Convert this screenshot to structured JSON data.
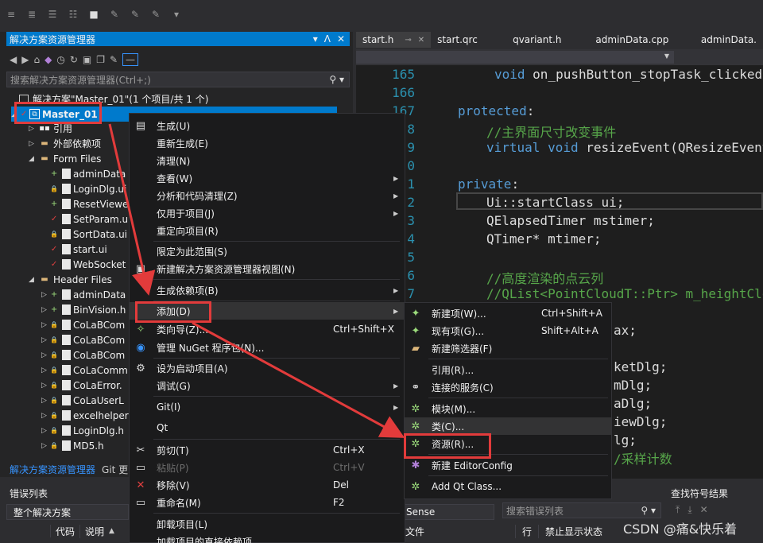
{
  "solution_explorer": {
    "title": "解决方案资源管理器",
    "title_buttons": [
      "▾",
      "ᐱ",
      "✕"
    ],
    "search_placeholder": "搜索解决方案资源管理器(Ctrl+;)",
    "solution_label": "解决方案\"Master_01\"(1 个项目/共 1 个)",
    "project": "Master_01",
    "tree": [
      {
        "label": "引用",
        "kind": "ref",
        "indent": 1
      },
      {
        "label": "外部依赖项",
        "kind": "ext",
        "indent": 1
      },
      {
        "label": "Form Files",
        "kind": "folder",
        "indent": 1
      },
      {
        "label": "adminData",
        "kind": "file",
        "indent": 2,
        "mark": "+"
      },
      {
        "label": "LoginDlg.ui",
        "kind": "file",
        "indent": 2,
        "mark": "lock"
      },
      {
        "label": "ResetViewer",
        "kind": "file",
        "indent": 2,
        "mark": "+"
      },
      {
        "label": "SetParam.ui",
        "kind": "file",
        "indent": 2,
        "mark": "check"
      },
      {
        "label": "SortData.ui",
        "kind": "file",
        "indent": 2,
        "mark": "lock"
      },
      {
        "label": "start.ui",
        "kind": "file",
        "indent": 2,
        "mark": "check"
      },
      {
        "label": "WebSocket",
        "kind": "file",
        "indent": 2,
        "mark": "check"
      },
      {
        "label": "Header Files",
        "kind": "folder",
        "indent": 1
      },
      {
        "label": "adminData",
        "kind": "hfile",
        "indent": 2,
        "mark": "+"
      },
      {
        "label": "BinVision.h",
        "kind": "hfile",
        "indent": 2,
        "mark": "+"
      },
      {
        "label": "CoLaBCom",
        "kind": "hfile",
        "indent": 2,
        "mark": "lock"
      },
      {
        "label": "CoLaBCom",
        "kind": "hfile",
        "indent": 2,
        "mark": "lock"
      },
      {
        "label": "CoLaBCom",
        "kind": "hfile",
        "indent": 2,
        "mark": "lock"
      },
      {
        "label": "CoLaComm",
        "kind": "hfile",
        "indent": 2,
        "mark": "lock"
      },
      {
        "label": "CoLaError.",
        "kind": "hfile",
        "indent": 2,
        "mark": "lock"
      },
      {
        "label": "CoLaUserL",
        "kind": "hfile",
        "indent": 2,
        "mark": "lock"
      },
      {
        "label": "excelhelper",
        "kind": "hfile",
        "indent": 2,
        "mark": "lock"
      },
      {
        "label": "LoginDlg.h",
        "kind": "hfile",
        "indent": 2,
        "mark": "lock"
      },
      {
        "label": "MD5.h",
        "kind": "hfile",
        "indent": 2,
        "mark": "lock"
      }
    ],
    "tabs": [
      "解决方案资源管理器",
      "Git 更"
    ]
  },
  "error_list": {
    "title": "错误列表",
    "scope": "整个解决方案",
    "columns": [
      "代码",
      "说明"
    ]
  },
  "editor": {
    "tabs": [
      "start.h",
      "start.qrc",
      "qvariant.h",
      "adminData.cpp",
      "adminData."
    ],
    "line_numbers": [
      "165",
      "166",
      "167",
      "8",
      "9",
      "0",
      "1",
      "2",
      "3",
      "4",
      "5",
      "6",
      "7"
    ]
  },
  "bottom": {
    "sense_label": "Sense",
    "error_search_placeholder": "搜索错误列表",
    "columns": [
      "文件",
      "行",
      "禁止显示状态"
    ],
    "find_title": "查找符号结果",
    "watermark": "CSDN @痛&快乐着"
  },
  "context_menu": {
    "items": [
      {
        "label": "生成(U)",
        "icon": "build-icon",
        "glyph": "▤"
      },
      {
        "label": "重新生成(E)"
      },
      {
        "label": "清理(N)"
      },
      {
        "label": "查看(W)",
        "submenu": true
      },
      {
        "label": "分析和代码清理(Z)",
        "submenu": true
      },
      {
        "label": "仅用于项目(J)",
        "submenu": true
      },
      {
        "label": "重定向项目(R)"
      },
      {
        "label": "限定为此范围(S)"
      },
      {
        "label": "新建解决方案资源管理器视图(N)",
        "icon": "new-view-icon",
        "glyph": "▣"
      },
      {
        "label": "生成依赖项(B)",
        "submenu": true
      },
      {
        "label": "添加(D)",
        "submenu": true,
        "highlight": true
      },
      {
        "label": "类向导(Z)...",
        "shortcut": "Ctrl+Shift+X",
        "icon": "class-wizard-icon",
        "glyph": "✧"
      },
      {
        "label": "管理 NuGet 程序包(N)...",
        "icon": "nuget-icon",
        "glyph": "◉"
      },
      {
        "label": "设为启动项目(A)",
        "icon": "gear-icon",
        "glyph": "⚙"
      },
      {
        "label": "调试(G)",
        "submenu": true
      },
      {
        "label": "Git(I)",
        "submenu": true
      },
      {
        "label": "Qt",
        "submenu": true
      },
      {
        "label": "剪切(T)",
        "shortcut": "Ctrl+X",
        "icon": "scissors-icon",
        "glyph": "✂"
      },
      {
        "label": "粘贴(P)",
        "shortcut": "Ctrl+V",
        "disabled": true,
        "icon": "paste-icon",
        "glyph": "▭"
      },
      {
        "label": "移除(V)",
        "shortcut": "Del",
        "icon": "remove-icon",
        "glyph": "✕"
      },
      {
        "label": "重命名(M)",
        "shortcut": "F2",
        "icon": "rename-icon",
        "glyph": "▭"
      },
      {
        "label": "卸载项目(L)"
      },
      {
        "label": "加载项目的直接依赖项"
      }
    ]
  },
  "add_submenu": {
    "items": [
      {
        "label": "新建项(W)...",
        "shortcut": "Ctrl+Shift+A",
        "icon": "new-item-icon",
        "glyph": "✦"
      },
      {
        "label": "现有项(G)...",
        "shortcut": "Shift+Alt+A",
        "icon": "existing-item-icon",
        "glyph": "✦"
      },
      {
        "label": "新建筛选器(F)",
        "icon": "new-filter-icon",
        "glyph": "▰"
      },
      {
        "label": "引用(R)..."
      },
      {
        "label": "连接的服务(C)",
        "icon": "connected-service-icon",
        "glyph": "⚭"
      },
      {
        "label": "模块(M)...",
        "icon": "module-icon",
        "glyph": "✲"
      },
      {
        "label": "类(C)...",
        "icon": "class-icon",
        "glyph": "✲",
        "hover": true
      },
      {
        "label": "资源(R)...",
        "icon": "resource-icon",
        "glyph": "✲"
      },
      {
        "label": "新建 EditorConfig",
        "icon": "editorconfig-icon",
        "glyph": "✱"
      },
      {
        "label": "Add Qt Class...",
        "icon": "qt-class-icon",
        "glyph": "✲"
      }
    ]
  }
}
